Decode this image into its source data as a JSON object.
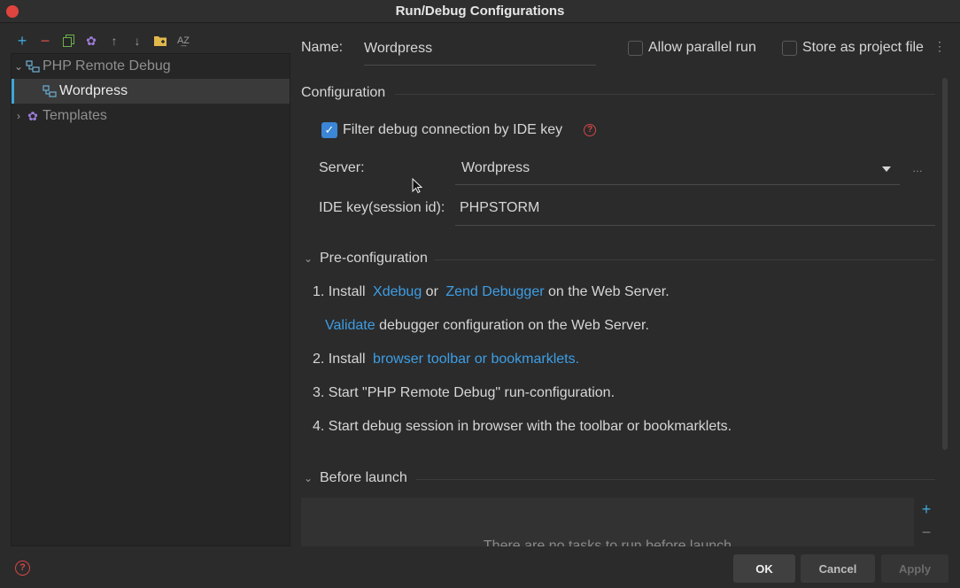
{
  "window": {
    "title": "Run/Debug Configurations"
  },
  "toolbar": {
    "icons": [
      "add-icon",
      "remove-icon",
      "copy-icon",
      "gear-icon",
      "arrow-up-icon",
      "arrow-down-icon",
      "folder-add-icon",
      "sort-alpha-icon"
    ]
  },
  "tree": {
    "group_label": "PHP Remote Debug",
    "selected_item": "Wordpress",
    "templates_label": "Templates"
  },
  "header": {
    "name_label": "Name:",
    "name_value": "Wordpress",
    "allow_parallel_label": "Allow parallel run",
    "allow_parallel_checked": false,
    "store_project_label": "Store as project file",
    "store_project_checked": false
  },
  "configuration": {
    "title": "Configuration",
    "filter_label": "Filter debug connection by IDE key",
    "filter_checked": true,
    "server_label": "Server:",
    "server_value": "Wordpress",
    "ide_key_label": "IDE key(session id):",
    "ide_key_value": "PHPSTORM"
  },
  "preconfig": {
    "title": "Pre-configuration",
    "step1_prefix": "1. Install",
    "step1_link1": "Xdebug",
    "step1_or": "or",
    "step1_link2": "Zend Debugger",
    "step1_suffix": "on the Web Server.",
    "validate_link": "Validate",
    "validate_suffix": "debugger configuration on the Web Server.",
    "step2_prefix": "2. Install",
    "step2_link": "browser toolbar or bookmarklets.",
    "step3": "3. Start \"PHP Remote Debug\" run-configuration.",
    "step4": "4. Start debug session in browser with the toolbar or bookmarklets."
  },
  "before_launch": {
    "title": "Before launch",
    "empty_text": "There are no tasks to run before launch"
  },
  "buttons": {
    "ok": "OK",
    "cancel": "Cancel",
    "apply": "Apply"
  },
  "colors": {
    "accent": "#3d9ee6",
    "checkbox": "#3b86d6",
    "error": "#d64646",
    "background": "#2b2b2b"
  }
}
